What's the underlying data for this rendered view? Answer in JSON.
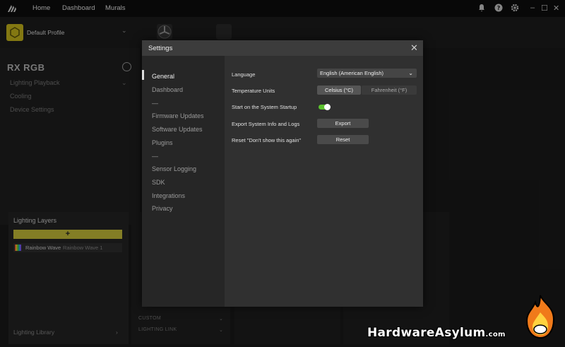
{
  "topbar": {
    "nav": [
      "Home",
      "Dashboard",
      "Murals"
    ],
    "window_controls": {
      "minimize": "–",
      "maximize": "☐",
      "close": "✕"
    }
  },
  "profile": {
    "name": "Default Profile"
  },
  "left_panel": {
    "title": "RX RGB",
    "items": [
      "Lighting Playback",
      "Cooling",
      "Device Settings"
    ]
  },
  "layers": {
    "title": "Lighting Layers",
    "add_label": "+",
    "rows": [
      {
        "name": "Rainbow Wave",
        "sub": "Rainbow Wave 1"
      }
    ],
    "library": "Lighting Library"
  },
  "mid_panel": {
    "items": [
      "CUSTOM",
      "LIGHTING LINK"
    ]
  },
  "settings": {
    "title": "Settings",
    "close": "✕",
    "nav": [
      "General",
      "Dashboard",
      "—",
      "Firmware Updates",
      "Software Updates",
      "Plugins",
      "—",
      "Sensor Logging",
      "SDK",
      "Integrations",
      "Privacy"
    ],
    "active_nav": "General",
    "rows": {
      "language_label": "Language",
      "language_value": "English (American English)",
      "temp_label": "Temperature Units",
      "temp_celsius": "Celsius (°C)",
      "temp_fahrenheit": "Fahrenheit (°F)",
      "startup_label": "Start on the System Startup",
      "export_label": "Export System Info and Logs",
      "export_button": "Export",
      "reset_label": "Reset \"Don't show this again\"",
      "reset_button": "Reset"
    }
  },
  "watermark": {
    "text": "HardwareAsylum",
    "domain": ".com"
  },
  "colors": {
    "accent_yellow": "#c9c23a",
    "toggle_on": "#5cc22e",
    "watermark_flame": "#f07a1a"
  }
}
